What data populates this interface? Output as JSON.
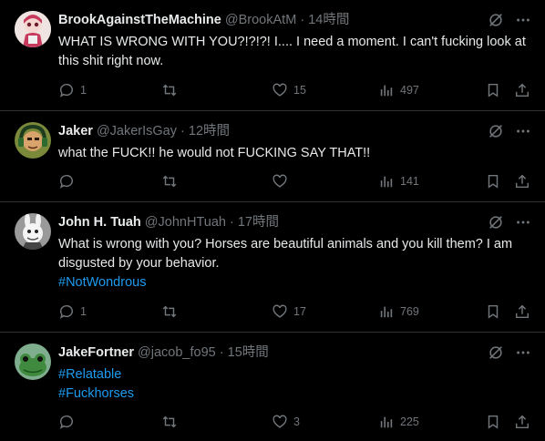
{
  "colors": {
    "accent": "#1d9bf0",
    "muted": "#71767b",
    "text": "#e7e9ea",
    "background": "#000000"
  },
  "tweets": [
    {
      "name": "BrookAgainstTheMachine",
      "handle": "@BrookAtM",
      "dot": "·",
      "time": "14時間",
      "text": "WHAT IS WRONG WITH YOU?!?!?! I.... I need a moment. I can't fucking look at this shit right now.",
      "hashtags": [],
      "replies": "1",
      "retweets": "",
      "likes": "15",
      "views": "497"
    },
    {
      "name": "Jaker",
      "handle": "@JakerIsGay",
      "dot": "·",
      "time": "12時間",
      "text": "what the FUCK!! he would not FUCKING SAY THAT!!",
      "hashtags": [],
      "replies": "",
      "retweets": "",
      "likes": "",
      "views": "141"
    },
    {
      "name": "John H. Tuah",
      "handle": "@JohnHTuah",
      "dot": "·",
      "time": "17時間",
      "text": "What is wrong with you? Horses are beautiful animals and you kill them? I am disgusted by your behavior.",
      "hashtags": [
        "#NotWondrous"
      ],
      "replies": "1",
      "retweets": "",
      "likes": "17",
      "views": "769"
    },
    {
      "name": "JakeFortner",
      "handle": "@jacob_fo95",
      "dot": "·",
      "time": "15時間",
      "text": "",
      "hashtags": [
        "#Relatable",
        "#Fuckhorses"
      ],
      "replies": "",
      "retweets": "",
      "likes": "3",
      "views": "225"
    }
  ]
}
